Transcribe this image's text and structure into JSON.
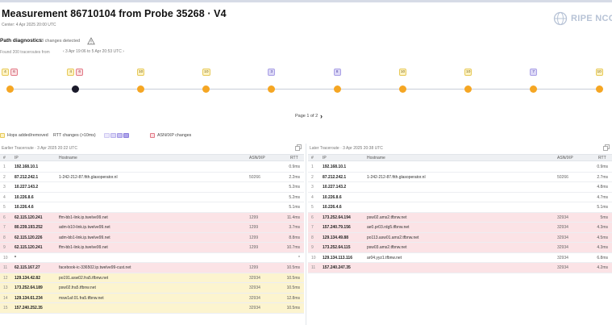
{
  "header": {
    "title": "Measurement 86710104 from Probe 35268 · V4",
    "subtitle": "Center: 4 Apr 2025 20:00 UTC",
    "logo_text": "RIPE NCC"
  },
  "path_diagnostics": {
    "title": "Path diagnostics",
    "count_label": "13 changes detected"
  },
  "found": {
    "label": "Found 200 traceroutes from",
    "range": "‹  3 Apr 19:06 to 5 Apr 20:53 UTC  ›"
  },
  "timeline": [
    {
      "badges": [
        {
          "kind": "hop",
          "text": "4"
        },
        {
          "kind": "asn",
          "text": "6"
        }
      ]
    },
    {
      "badges": [
        {
          "kind": "hop",
          "text": "4"
        },
        {
          "kind": "asn",
          "text": "6"
        }
      ],
      "selected": true
    },
    {
      "badges": [
        {
          "kind": "hop",
          "text": "10"
        }
      ]
    },
    {
      "badges": [
        {
          "kind": "hop",
          "text": "10"
        }
      ]
    },
    {
      "badges": [
        {
          "kind": "rtt",
          "text": "3"
        }
      ]
    },
    {
      "badges": [
        {
          "kind": "rtt",
          "text": "8"
        }
      ]
    },
    {
      "badges": [
        {
          "kind": "hop",
          "text": "10"
        }
      ]
    },
    {
      "badges": [
        {
          "kind": "hop",
          "text": "10"
        }
      ]
    },
    {
      "badges": [
        {
          "kind": "rtt",
          "text": "7"
        }
      ]
    },
    {
      "badges": [
        {
          "kind": "hop",
          "text": "10"
        }
      ]
    }
  ],
  "pager": {
    "label": "Page 1 of 2",
    "next": "›"
  },
  "legend": {
    "hops": "Hops added/removed",
    "rtt": "RTT changes (>10ms)",
    "asn": "ASN/IXP changes"
  },
  "colors": {
    "orange": "#f5a623",
    "asn_row": "#fbe3e6",
    "hop_row": "#fcf4cf",
    "rtt": "#aaa0e6"
  },
  "left": {
    "title": "Earlier Traceroute · 3 Apr 2025 20:22 UTC",
    "columns": {
      "num": "#",
      "ip": "IP",
      "host": "Hostname",
      "asn": "ASN/IXP",
      "rtt": "RTT"
    },
    "rows": [
      {
        "n": "1",
        "ip": "192.168.10.1",
        "host": "",
        "asn": "",
        "rtt": "0.9ms",
        "kind": ""
      },
      {
        "n": "2",
        "ip": "87.212.242.1",
        "host": "1-242-212-87.ftth.glasoperator.nl",
        "asn": "50266",
        "rtt": "2.2ms",
        "kind": ""
      },
      {
        "n": "3",
        "ip": "10.227.143.2",
        "host": "",
        "asn": "",
        "rtt": "5.2ms",
        "kind": ""
      },
      {
        "n": "4",
        "ip": "10.226.8.6",
        "host": "",
        "asn": "",
        "rtt": "5.2ms",
        "kind": ""
      },
      {
        "n": "5",
        "ip": "10.226.4.6",
        "host": "",
        "asn": "",
        "rtt": "5.1ms",
        "kind": ""
      },
      {
        "n": "6",
        "ip": "62.115.120.241",
        "host": "ffm-bb1-link.ip.twelve99.net",
        "asn": "1299",
        "rtt": "11.4ms",
        "kind": "asn"
      },
      {
        "n": "7",
        "ip": "80.239.193.252",
        "host": "adm-b10-link.ip.twelve99.net",
        "asn": "1299",
        "rtt": "3.7ms",
        "kind": "asn"
      },
      {
        "n": "8",
        "ip": "62.115.120.226",
        "host": "adm-bb1-link.ip.twelve99.net",
        "asn": "1299",
        "rtt": "8.8ms",
        "kind": "asn"
      },
      {
        "n": "9",
        "ip": "62.115.120.241",
        "host": "ffm-bb1-link.ip.twelve99.net",
        "asn": "1299",
        "rtt": "10.7ms",
        "kind": "asn"
      },
      {
        "n": "10",
        "ip": "*",
        "host": "",
        "asn": "",
        "rtt": "*",
        "kind": ""
      },
      {
        "n": "11",
        "ip": "62.115.167.27",
        "host": "facebook-ic-336502.ip.twelve99-cust.net",
        "asn": "1299",
        "rtt": "10.5ms",
        "kind": "asn"
      },
      {
        "n": "12",
        "ip": "129.134.42.82",
        "host": "po191.asw02.fra5.tfbnw.net",
        "asn": "32934",
        "rtt": "10.5ms",
        "kind": "hop"
      },
      {
        "n": "13",
        "ip": "173.252.64.189",
        "host": "psw02.fra5.tfbnw.net",
        "asn": "32934",
        "rtt": "10.5ms",
        "kind": "hop"
      },
      {
        "n": "14",
        "ip": "129.134.61.234",
        "host": "msw1af.01.fra5.tfbnw.net",
        "asn": "32934",
        "rtt": "12.8ms",
        "kind": "hop"
      },
      {
        "n": "15",
        "ip": "157.240.252.35",
        "host": "",
        "asn": "32934",
        "rtt": "10.5ms",
        "kind": "hop"
      }
    ]
  },
  "right": {
    "title": "Later Traceroute · 3 Apr 2025 20:38 UTC",
    "columns": {
      "num": "#",
      "ip": "IP",
      "host": "Hostname",
      "asn": "ASN/IXP",
      "rtt": "RTT"
    },
    "rows": [
      {
        "n": "1",
        "ip": "192.168.10.1",
        "host": "",
        "asn": "",
        "rtt": "0.9ms",
        "kind": ""
      },
      {
        "n": "2",
        "ip": "87.212.242.1",
        "host": "1-242-212-87.ftth.glasoperator.nl",
        "asn": "50266",
        "rtt": "2.7ms",
        "kind": ""
      },
      {
        "n": "3",
        "ip": "10.227.143.2",
        "host": "",
        "asn": "",
        "rtt": "4.8ms",
        "kind": ""
      },
      {
        "n": "4",
        "ip": "10.226.8.6",
        "host": "",
        "asn": "",
        "rtt": "4.7ms",
        "kind": ""
      },
      {
        "n": "5",
        "ip": "10.226.4.6",
        "host": "",
        "asn": "",
        "rtt": "5.1ms",
        "kind": ""
      },
      {
        "n": "6",
        "ip": "173.252.64.194",
        "host": "psw02.ams2.tfbnw.net",
        "asn": "32934",
        "rtt": "5ms",
        "kind": "asn"
      },
      {
        "n": "7",
        "ip": "157.240.79.156",
        "host": "ae0.pr03.rdg5.tfbnw.net",
        "asn": "32934",
        "rtt": "4.3ms",
        "kind": "asn"
      },
      {
        "n": "8",
        "ip": "129.134.49.88",
        "host": "po113.asw01.ams2.tfbnw.net",
        "asn": "32934",
        "rtt": "4.5ms",
        "kind": "asn"
      },
      {
        "n": "9",
        "ip": "173.252.64.115",
        "host": "psw03.ams2.tfbnw.net",
        "asn": "32934",
        "rtt": "4.3ms",
        "kind": "asn"
      },
      {
        "n": "10",
        "ip": "129.134.113.116",
        "host": "ar04.yyz1.tfbnw.net",
        "asn": "32934",
        "rtt": "6.8ms",
        "kind": ""
      },
      {
        "n": "11",
        "ip": "157.240.247.35",
        "host": "",
        "asn": "32934",
        "rtt": "4.2ms",
        "kind": "asn"
      }
    ]
  }
}
